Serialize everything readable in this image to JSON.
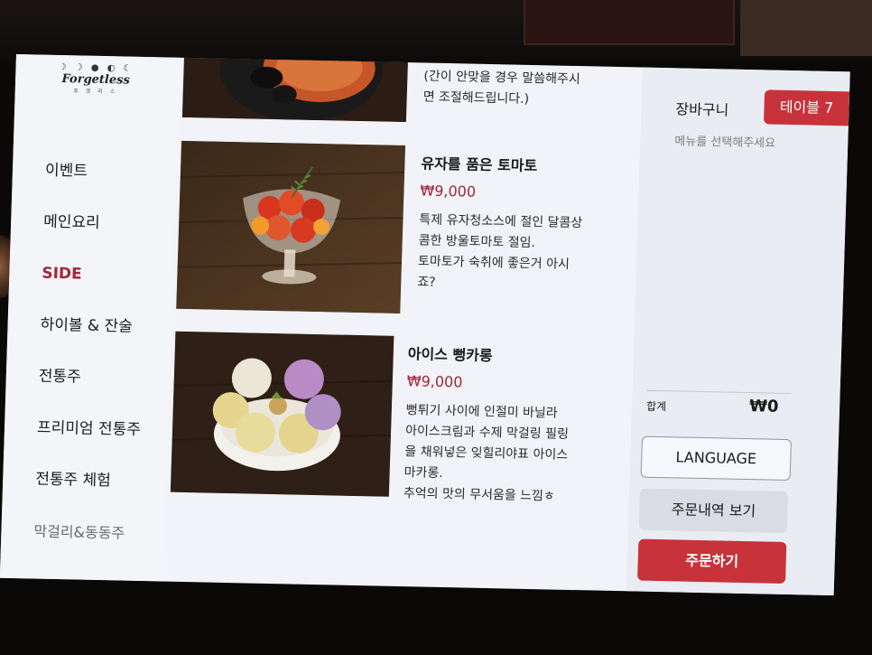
{
  "app": {
    "logo_moons": "☽ ☽ ● ◐ ☾",
    "logo_name": "Forgetless",
    "logo_sub": "포 겟 리 스"
  },
  "sidebar": {
    "items": [
      {
        "label": "이벤트"
      },
      {
        "label": "메인요리"
      },
      {
        "label": "SIDE",
        "active": true
      },
      {
        "label": "하이볼 & 잔술"
      },
      {
        "label": "전통주"
      },
      {
        "label": "프리미엄 전통주"
      },
      {
        "label": "전통주 체험"
      },
      {
        "label": "막걸리&동동주"
      }
    ]
  },
  "menu": {
    "top_item": {
      "desc": "(간이 안맞을 경우 말씀해주시\n면 조절해드립니다.)"
    },
    "items": [
      {
        "name": "유자를 품은 토마토",
        "price": "₩9,000",
        "desc": "특제 유자청소스에 절인 달콤상\n콤한 방울토마토 절임.\n토마토가 숙취에 좋은거 아시\n죠?"
      },
      {
        "name": "아이스 뻥카롱",
        "price": "₩9,000",
        "desc": "뻥튀기 사이에 인절미 바닐라\n아이스크림과 수제 막걸링 필링\n을 채워넣은 잊힐리야표 아이스\n마카롱.\n추억의 맛의 무서움을 느낌ㅎ"
      }
    ]
  },
  "cart": {
    "title": "장바구니",
    "table": "테이블 7",
    "empty_message": "메뉴를 선택해주세요",
    "sum_label": "합계",
    "sum_value": "₩0",
    "language_button": "LANGUAGE",
    "history_button": "주문내역 보기",
    "order_button": "주문하기"
  },
  "colors": {
    "accent": "#c8323a",
    "active_nav": "#a3283a"
  }
}
